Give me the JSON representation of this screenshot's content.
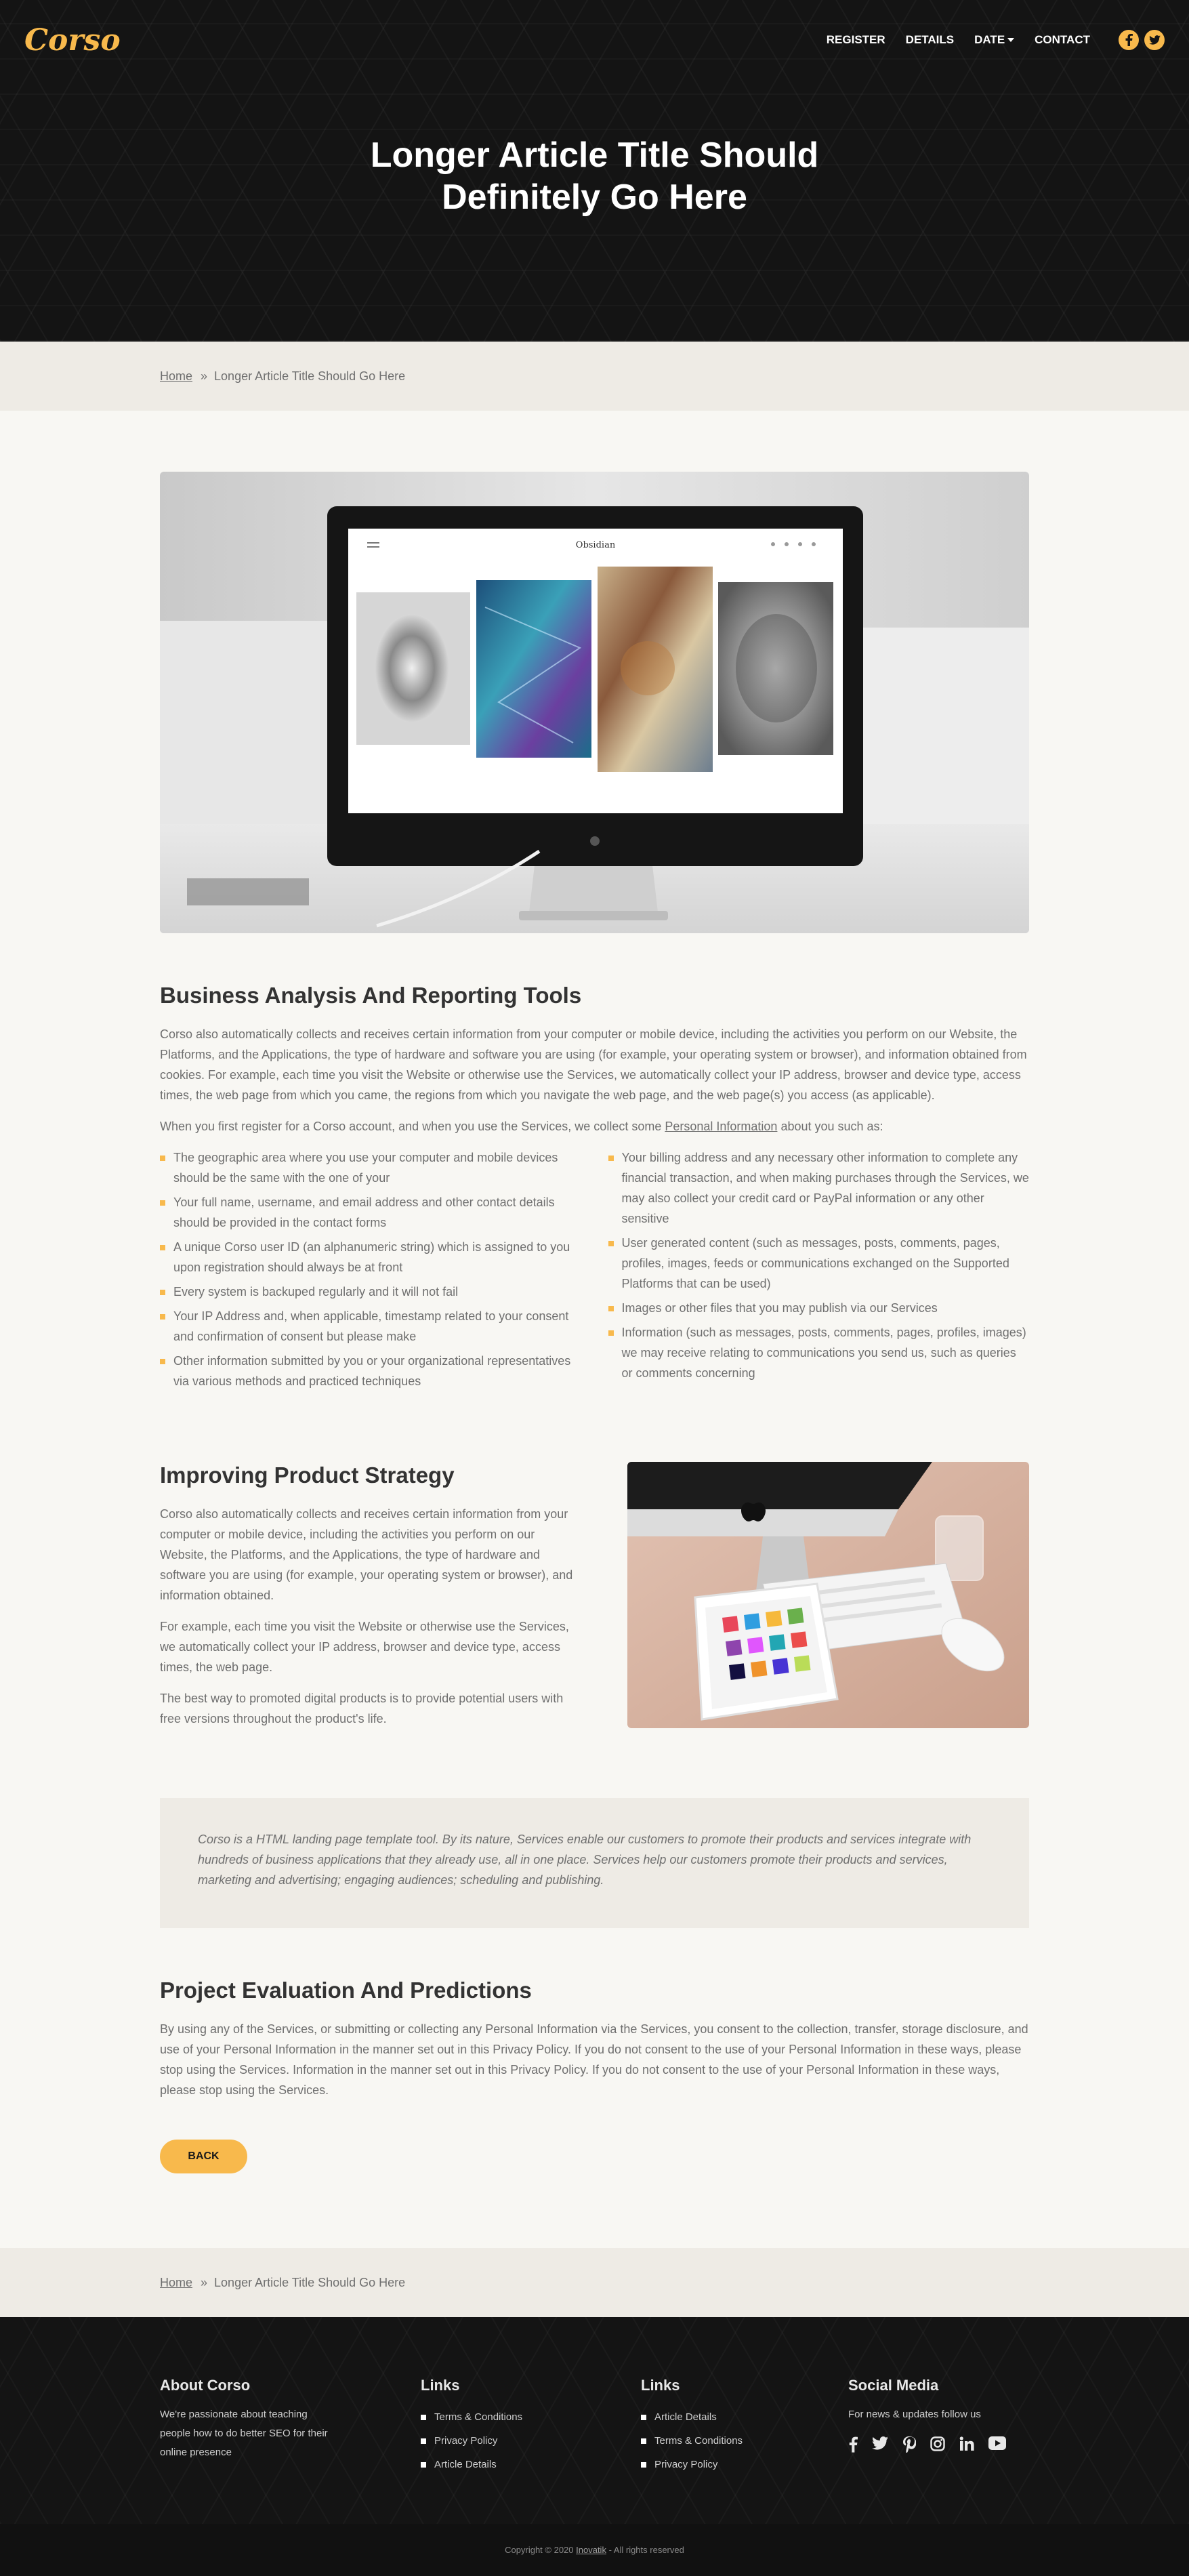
{
  "header": {
    "logo": "Corso",
    "nav": [
      {
        "label": "REGISTER"
      },
      {
        "label": "DETAILS"
      },
      {
        "label": "DATE"
      },
      {
        "label": "CONTACT"
      }
    ],
    "title": "Longer Article Title Should Definitely Go Here"
  },
  "breadcrumb": {
    "home": "Home",
    "separator": "»",
    "current": "Longer Article Title Should Go Here"
  },
  "section1": {
    "title": "Business Analysis And Reporting Tools",
    "para1": "Corso also automatically collects and receives certain information from your computer or mobile device, including the activities you perform on our Website, the Platforms, and the Applications, the type of hardware and software you are using (for example, your operating system or browser), and information obtained from cookies. For example, each time you visit the Website or otherwise use the Services, we automatically collect your IP address, browser and device type, access times, the web page from which you came, the regions from which you navigate the web page, and the web page(s) you access (as applicable).",
    "para2_before": "When you first register for a Corso account, and when you use the Services, we collect some ",
    "para2_link": "Personal Information",
    "para2_after": " about you such as:",
    "bullets_left": [
      "The geographic area where you use your computer and mobile devices should be the same with the one of your",
      "Your full name, username, and email address and other contact details should be provided in the contact forms",
      "A unique Corso user ID (an alphanumeric string) which is assigned to you upon registration should always be at front",
      "Every system is backuped regularly and it will not fail",
      "Your IP Address and, when applicable, timestamp related to your consent and confirmation of consent but please make",
      "Other information submitted by you or your organizational representatives via various methods and practiced techniques"
    ],
    "bullets_right": [
      "Your billing address and any necessary other information to complete any financial transaction, and when making purchases through the Services, we may also collect your credit card or PayPal information or any other sensitive",
      "User generated content (such as messages, posts, comments, pages, profiles, images, feeds or communications exchanged on the Supported Platforms that can be used)",
      "Images or other files that you may publish via our Services",
      "Information (such as messages, posts, comments, pages, profiles, images) we may receive relating to communications you send us, such as queries or comments concerning"
    ],
    "screen_brand": "Obsidian"
  },
  "section2": {
    "title": "Improving Product Strategy",
    "para1": "Corso also automatically collects and receives certain information from your computer or mobile device, including the activities you perform on our Website, the Platforms, and the Applications, the type of hardware and software you are using (for example, your operating system or browser), and information obtained.",
    "para2": "For example, each time you visit the Website or otherwise use the Services, we automatically collect your IP address, browser and device type, access times, the web page.",
    "para3": "The best way to promoted digital products is to provide potential users with free versions throughout the product's life."
  },
  "quote": {
    "text": "Corso is a HTML landing page template tool. By its nature, Services enable our customers to promote their products and services integrate with hundreds of business applications that they already use, all in one place. Services help our customers promote their products and services, marketing and advertising; engaging audiences; scheduling and publishing."
  },
  "section3": {
    "title": "Project Evaluation And Predictions",
    "para1": "By using any of the Services, or submitting or collecting any Personal Information via the Services, you consent to the collection, transfer, storage disclosure, and use of your Personal Information in the manner set out in this Privacy Policy. If you do not consent to the use of your Personal Information in these ways, please stop using the Services. Information in the manner set out in this Privacy Policy. If you do not consent to the use of your Personal Information in these ways, please stop using the Services.",
    "back_label": "BACK"
  },
  "footer": {
    "about_title": "About Corso",
    "about_text": "We're passionate about teaching people how to do better SEO for their online presence",
    "links1_title": "Links",
    "links1": [
      "Terms & Conditions",
      "Privacy Policy",
      "Article Details"
    ],
    "links2_title": "Links",
    "links2": [
      "Article Details",
      "Terms & Conditions",
      "Privacy Policy"
    ],
    "social_title": "Social Media",
    "social_text": "For news & updates follow us",
    "social_icons": [
      "facebook-icon",
      "twitter-icon",
      "pinterest-icon",
      "instagram-icon",
      "linkedin-icon",
      "youtube-icon"
    ],
    "copyright_before": "Copyright © 2020 ",
    "copyright_link": "Inovatik",
    "copyright_after": " - All rights reserved"
  },
  "colors": {
    "accent": "#f8b94c",
    "dark": "#141414",
    "band": "#eeebe5",
    "page": "#f8f7f3"
  }
}
